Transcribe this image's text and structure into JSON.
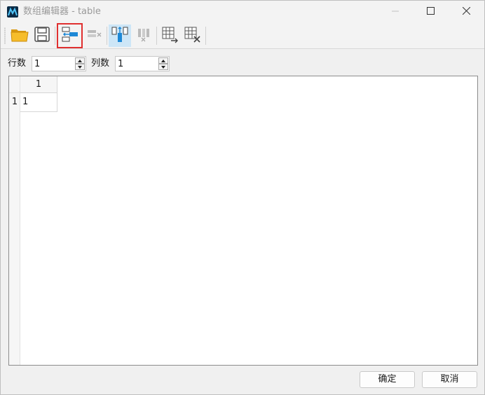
{
  "window": {
    "title": "数组编辑器 - table",
    "app_icon": "matlab-logo-icon",
    "controls": [
      "minimize-icon",
      "maximize-icon",
      "close-icon"
    ]
  },
  "toolbar": {
    "buttons": [
      {
        "name": "open-file-button",
        "icon": "folder-open-icon"
      },
      {
        "name": "save-button",
        "icon": "save-icon"
      },
      {
        "name": "insert-row-button",
        "icon": "insert-row-icon",
        "highlighted": true
      },
      {
        "name": "delete-row-button",
        "icon": "delete-row-icon",
        "disabled": true
      },
      {
        "name": "insert-column-button",
        "icon": "insert-column-icon",
        "pressed": true
      },
      {
        "name": "delete-column-button",
        "icon": "delete-column-icon",
        "disabled": true
      },
      {
        "name": "import-table-button",
        "icon": "table-import-icon"
      },
      {
        "name": "clear-table-button",
        "icon": "table-clear-icon"
      }
    ]
  },
  "dims": {
    "rows_label": "行数",
    "rows_value": "1",
    "cols_label": "列数",
    "cols_value": "1"
  },
  "table": {
    "column_headers": [
      "1"
    ],
    "row_headers": [
      "1"
    ],
    "cells": [
      [
        "1"
      ]
    ]
  },
  "buttons": {
    "ok": "确定",
    "cancel": "取消"
  },
  "colors": {
    "accent_blue": "#1e88d6",
    "highlight_border": "#e03030",
    "folder_yellow": "#f0b429"
  }
}
